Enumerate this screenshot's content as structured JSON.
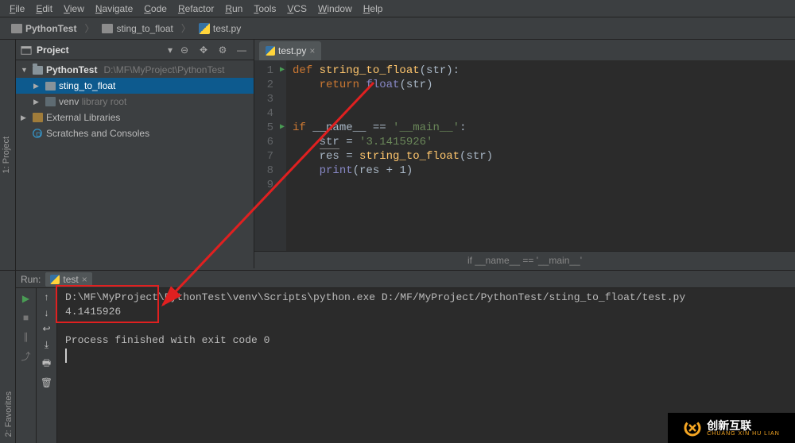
{
  "menu": [
    "File",
    "Edit",
    "View",
    "Navigate",
    "Code",
    "Refactor",
    "Run",
    "Tools",
    "VCS",
    "Window",
    "Help"
  ],
  "breadcrumb": {
    "project": "PythonTest",
    "folder": "sting_to_float",
    "file": "test.py"
  },
  "left_rail": {
    "project": "1: Project",
    "favorites": "2: Favorites"
  },
  "project_panel": {
    "title": "Project",
    "root": {
      "label": "PythonTest",
      "path": "D:\\MF\\MyProject\\PythonTest"
    },
    "selected_folder": "sting_to_float",
    "venv_label": "venv",
    "venv_suffix": "library root",
    "external": "External Libraries",
    "scratches": "Scratches and Consoles"
  },
  "editor": {
    "tab_label": "test.py",
    "lines": [
      "1",
      "2",
      "3",
      "4",
      "5",
      "6",
      "7",
      "8",
      "9"
    ],
    "code_tokens": [
      [
        [
          "kw",
          "def "
        ],
        [
          "fn",
          "string_to_float"
        ],
        [
          "txt",
          "("
        ],
        [
          "param",
          "str"
        ],
        [
          "txt",
          "):"
        ]
      ],
      [
        [
          "txt",
          "    "
        ],
        [
          "kw",
          "return "
        ],
        [
          "builtin",
          "float"
        ],
        [
          "txt",
          "("
        ],
        [
          "param",
          "str"
        ],
        [
          "txt",
          ")"
        ]
      ],
      [],
      [],
      [
        [
          "kw",
          "if "
        ],
        [
          "txt",
          "__name__ == "
        ],
        [
          "str",
          "'__main__'"
        ],
        [
          "txt",
          ":"
        ]
      ],
      [
        [
          "txt",
          "    "
        ],
        [
          "param underline",
          "str"
        ],
        [
          "txt",
          " = "
        ],
        [
          "str",
          "'3.1415926'"
        ]
      ],
      [
        [
          "txt",
          "    res = "
        ],
        [
          "fn",
          "string_to_float"
        ],
        [
          "txt",
          "("
        ],
        [
          "param",
          "str"
        ],
        [
          "txt",
          ")"
        ]
      ],
      [
        [
          "txt",
          "    "
        ],
        [
          "builtin",
          "print"
        ],
        [
          "txt",
          "(res + "
        ],
        [
          "txt",
          "1"
        ],
        [
          "txt",
          ")"
        ]
      ],
      []
    ],
    "breadcrumb_bottom": "if __name__ == '__main__'"
  },
  "run": {
    "label": "Run:",
    "config": "test",
    "output": [
      "D:\\MF\\MyProject\\PythonTest\\venv\\Scripts\\python.exe D:/MF/MyProject/PythonTest/sting_to_float/test.py",
      "4.1415926",
      "",
      "Process finished with exit code 0",
      ""
    ]
  },
  "logo": {
    "brand": "创新互联",
    "sub": "CHUANG XIN HU LIAN"
  }
}
